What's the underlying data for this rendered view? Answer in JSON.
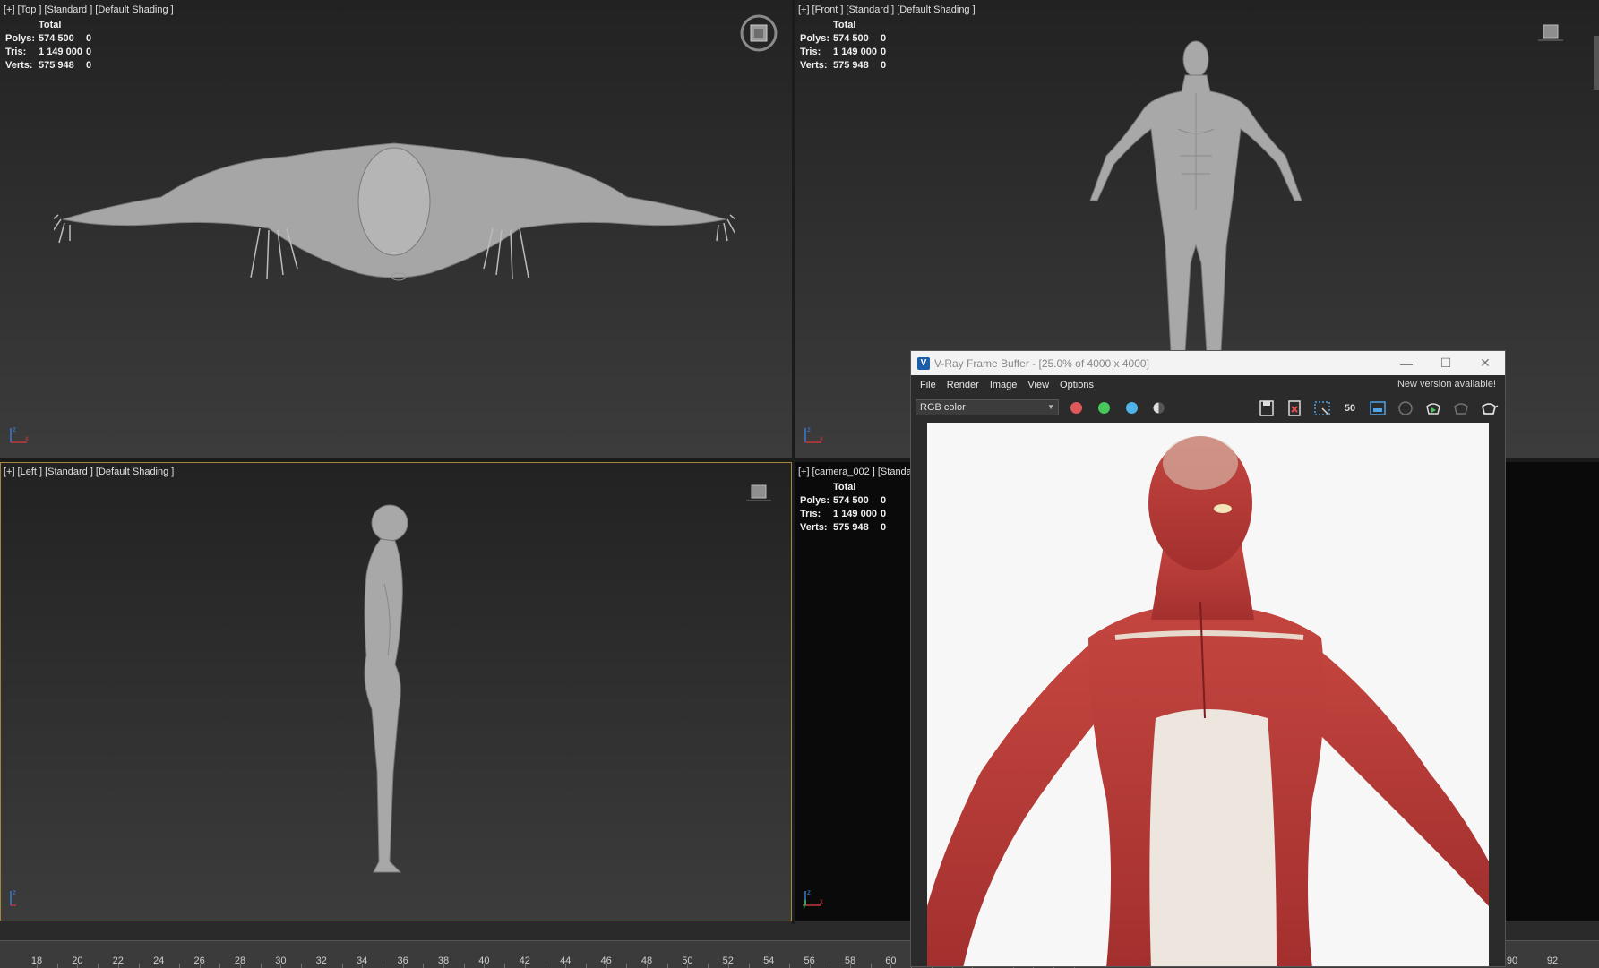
{
  "viewports": {
    "top": {
      "label": [
        "[+]",
        "[Top ]",
        "[Standard ]",
        "[Default Shading ]"
      ],
      "stats": {
        "header": "Total",
        "rows": [
          {
            "key": "Polys:",
            "total": "574 500",
            "sel": "0"
          },
          {
            "key": "Tris:",
            "total": "1 149 000",
            "sel": "0"
          },
          {
            "key": "Verts:",
            "total": "575 948",
            "sel": "0"
          }
        ]
      }
    },
    "front": {
      "label": [
        "[+]",
        "[Front ]",
        "[Standard ]",
        "[Default Shading ]"
      ],
      "stats": {
        "header": "Total",
        "rows": [
          {
            "key": "Polys:",
            "total": "574 500",
            "sel": "0"
          },
          {
            "key": "Tris:",
            "total": "1 149 000",
            "sel": "0"
          },
          {
            "key": "Verts:",
            "total": "575 948",
            "sel": "0"
          }
        ]
      }
    },
    "left": {
      "label": [
        "[+]",
        "[Left ]",
        "[Standard ]",
        "[Default Shading ]"
      ]
    },
    "camera": {
      "label": [
        "[+]",
        "[camera_002 ]",
        "[Standa"
      ],
      "stats": {
        "header": "Total",
        "rows": [
          {
            "key": "Polys:",
            "total": "574 500",
            "sel": "0"
          },
          {
            "key": "Tris:",
            "total": "1 149 000",
            "sel": "0"
          },
          {
            "key": "Verts:",
            "total": "575 948",
            "sel": "0"
          }
        ]
      }
    }
  },
  "axis_labels": {
    "x": "x",
    "y": "y",
    "z": "z"
  },
  "vfb": {
    "title": "V-Ray Frame Buffer - [25.0% of 4000 x 4000]",
    "menu": [
      "File",
      "Render",
      "Image",
      "View",
      "Options"
    ],
    "new_version": "New version available!",
    "channel_select": "RGB color",
    "zoom_button": "50",
    "channel_colors": {
      "red": "#e0585a",
      "green": "#47c85a",
      "blue": "#4fb3e8"
    }
  },
  "timeline": {
    "labels": [
      "18",
      "20",
      "22",
      "24",
      "26",
      "28",
      "30",
      "32",
      "34",
      "36",
      "38",
      "40",
      "42",
      "44",
      "46",
      "48",
      "50",
      "52",
      "54",
      "56",
      "58",
      "60"
    ],
    "right_labels": [
      "90",
      "92"
    ]
  },
  "colors": {
    "accent_active_viewport": "#a4883a",
    "muscle_red": "#b83a38",
    "model_gray": "#a8a8a8"
  }
}
